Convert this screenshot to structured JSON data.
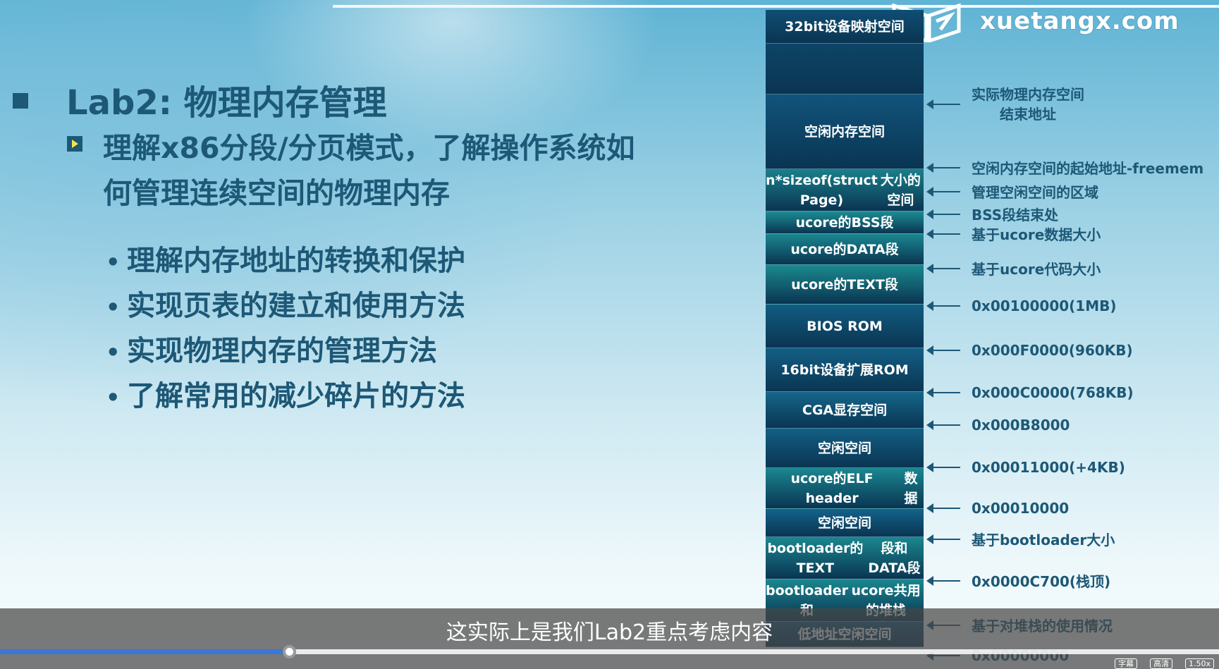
{
  "brand": {
    "logo_text": "xuetangx.com"
  },
  "slide": {
    "title": "Lab2: 物理内存管理",
    "subtitle": "理解x86分段/分页模式，了解操作系统如何管理连续空间的物理内存",
    "bullets": [
      "理解内存地址的转换和保护",
      "实现页表的建立和使用方法",
      "实现物理内存的管理方法",
      "了解常用的减少碎片的方法"
    ]
  },
  "memory_map": {
    "blocks": [
      {
        "lines": [
          "32bit设备映射空间"
        ],
        "color": "#0f4e74"
      },
      {
        "lines": [
          ""
        ],
        "color": "#0d4467"
      },
      {
        "lines": [
          "空闲内存空间"
        ],
        "color": "#11547c"
      },
      {
        "lines": [
          "n*sizeof(struct Page)",
          "大小的空间"
        ],
        "color": "#1a7f8a"
      },
      {
        "lines": [
          "ucore的BSS段"
        ],
        "color": "#1c8c93"
      },
      {
        "lines": [
          "ucore的DATA段"
        ],
        "color": "#1a8790"
      },
      {
        "lines": [
          "ucore的TEXT段"
        ],
        "color": "#1a8a8e"
      },
      {
        "lines": [
          "BIOS ROM"
        ],
        "color": "#125c82"
      },
      {
        "lines": [
          "16bit设备扩展ROM"
        ],
        "color": "#135f84"
      },
      {
        "lines": [
          "CGA显存空间"
        ],
        "color": "#15668a"
      },
      {
        "lines": [
          "空闲空间"
        ],
        "color": "#135f84"
      },
      {
        "lines": [
          "ucore的ELF header",
          "数据"
        ],
        "color": "#1a8790"
      },
      {
        "lines": [
          "空闲空间"
        ],
        "color": "#13628a"
      },
      {
        "lines": [
          "bootloader的TEXT",
          "段和DATA段"
        ],
        "color": "#1a878f"
      },
      {
        "lines": [
          "bootloader和",
          "ucore共用的堆栈"
        ],
        "color": "#1a868f"
      },
      {
        "lines": [
          "低地址空闲空间"
        ],
        "color": "#125a80"
      }
    ],
    "annotations": [
      {
        "lines": [
          "实际物理内存空间",
          "结束地址"
        ]
      },
      {
        "lines": [
          "空闲内存空间的起始地址-freemem"
        ]
      },
      {
        "lines": [
          "管理空闲空间的区域"
        ]
      },
      {
        "lines": [
          "BSS段结束处"
        ]
      },
      {
        "lines": [
          "基于ucore数据大小"
        ]
      },
      {
        "lines": [
          "基于ucore代码大小"
        ]
      },
      {
        "lines": [
          "0x00100000(1MB)"
        ]
      },
      {
        "lines": [
          "0x000F0000(960KB)"
        ]
      },
      {
        "lines": [
          "0x000C0000(768KB)"
        ]
      },
      {
        "lines": [
          "0x000B8000"
        ]
      },
      {
        "lines": [
          "0x00011000(+4KB)"
        ]
      },
      {
        "lines": [
          "0x00010000"
        ]
      },
      {
        "lines": [
          "基于bootloader大小"
        ]
      },
      {
        "lines": [
          "0x0000C700(栈顶)"
        ]
      },
      {
        "lines": [
          "基于对堆栈的使用情况"
        ]
      },
      {
        "lines": [
          "0x00000000"
        ]
      }
    ]
  },
  "player": {
    "caption": "这实际上是我们Lab2重点考虑内容",
    "progress": 0.237,
    "buttons": {
      "subtitles": "字幕",
      "quality": "高清",
      "speed": "1.50x"
    },
    "colors": {
      "progress": "#3a78d8"
    }
  }
}
